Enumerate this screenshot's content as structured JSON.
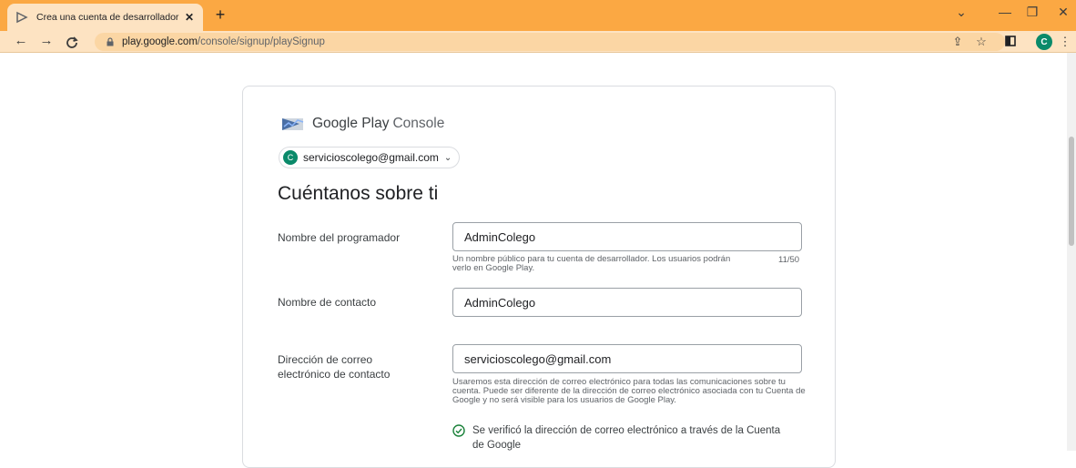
{
  "browser": {
    "tab_title": "Crea una cuenta de desarrollador",
    "tab_close": "✕",
    "new_tab": "+",
    "url_host": "play.google.com",
    "url_path": "/console/signup/playSignup",
    "profile_initial": "C",
    "accent_color": "#fba843",
    "window_controls": [
      "⌄",
      "—",
      "❐",
      "✕"
    ]
  },
  "page": {
    "brand_primary": "Google Play",
    "brand_secondary": "Console",
    "account_initial": "C",
    "account_email": "servicioscolego@gmail.com",
    "heading": "Cuéntanos sobre ti",
    "developer_name": {
      "label": "Nombre del programador",
      "value": "AdminColego",
      "helper": "Un nombre público para tu cuenta de desarrollador. Los usuarios podrán verlo en Google Play.",
      "counter": "11/50"
    },
    "contact_name": {
      "label": "Nombre de contacto",
      "value": "AdminColego"
    },
    "contact_email": {
      "label": "Dirección de correo electrónico de contacto",
      "value": "servicioscolego@gmail.com",
      "helper": "Usaremos esta dirección de correo electrónico para todas las comunicaciones sobre tu cuenta. Puede ser diferente de la dirección de correo electrónico asociada con tu Cuenta de Google y no será visible para los usuarios de Google Play.",
      "verified": "Se verificó la dirección de correo electrónico a través de la Cuenta de Google"
    }
  }
}
